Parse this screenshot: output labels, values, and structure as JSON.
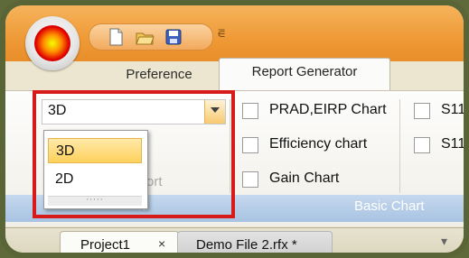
{
  "title_bar": {
    "app_icon": "radiation-pattern-orb-icon",
    "quick_access": [
      {
        "name": "new-file-icon"
      },
      {
        "name": "open-folder-icon"
      },
      {
        "name": "save-icon"
      }
    ],
    "customize_symbol": "⋷"
  },
  "tabs": [
    {
      "label": "Preference",
      "active": false
    },
    {
      "label": "Report Generator",
      "active": true
    }
  ],
  "combo": {
    "value": "3D",
    "options": [
      "3D",
      "2D"
    ],
    "selected": "3D"
  },
  "ghost_text": "ort",
  "groups": {
    "first_label_partial": "l",
    "basic_chart_label": "Basic Chart"
  },
  "checkboxes": [
    {
      "label": "PRAD,EIRP Chart",
      "checked": false
    },
    {
      "label": "Efficiency chart",
      "checked": false
    },
    {
      "label": "Gain Chart",
      "checked": false
    },
    {
      "label": "S11",
      "checked": false
    },
    {
      "label": "S11",
      "checked": false
    }
  ],
  "doc_tabs": [
    {
      "label": "Project1",
      "active": true,
      "close_symbol": "×"
    },
    {
      "label": "Demo File 2.rfx *",
      "active": false
    }
  ],
  "overflow_symbol": "▾",
  "colors": {
    "frame": "#5a6537",
    "title_orange": "#ef9a36",
    "highlight_red": "#d71a1a",
    "group_bar_blue": "#a8c3e2",
    "selected_item": "#ffd15c"
  }
}
